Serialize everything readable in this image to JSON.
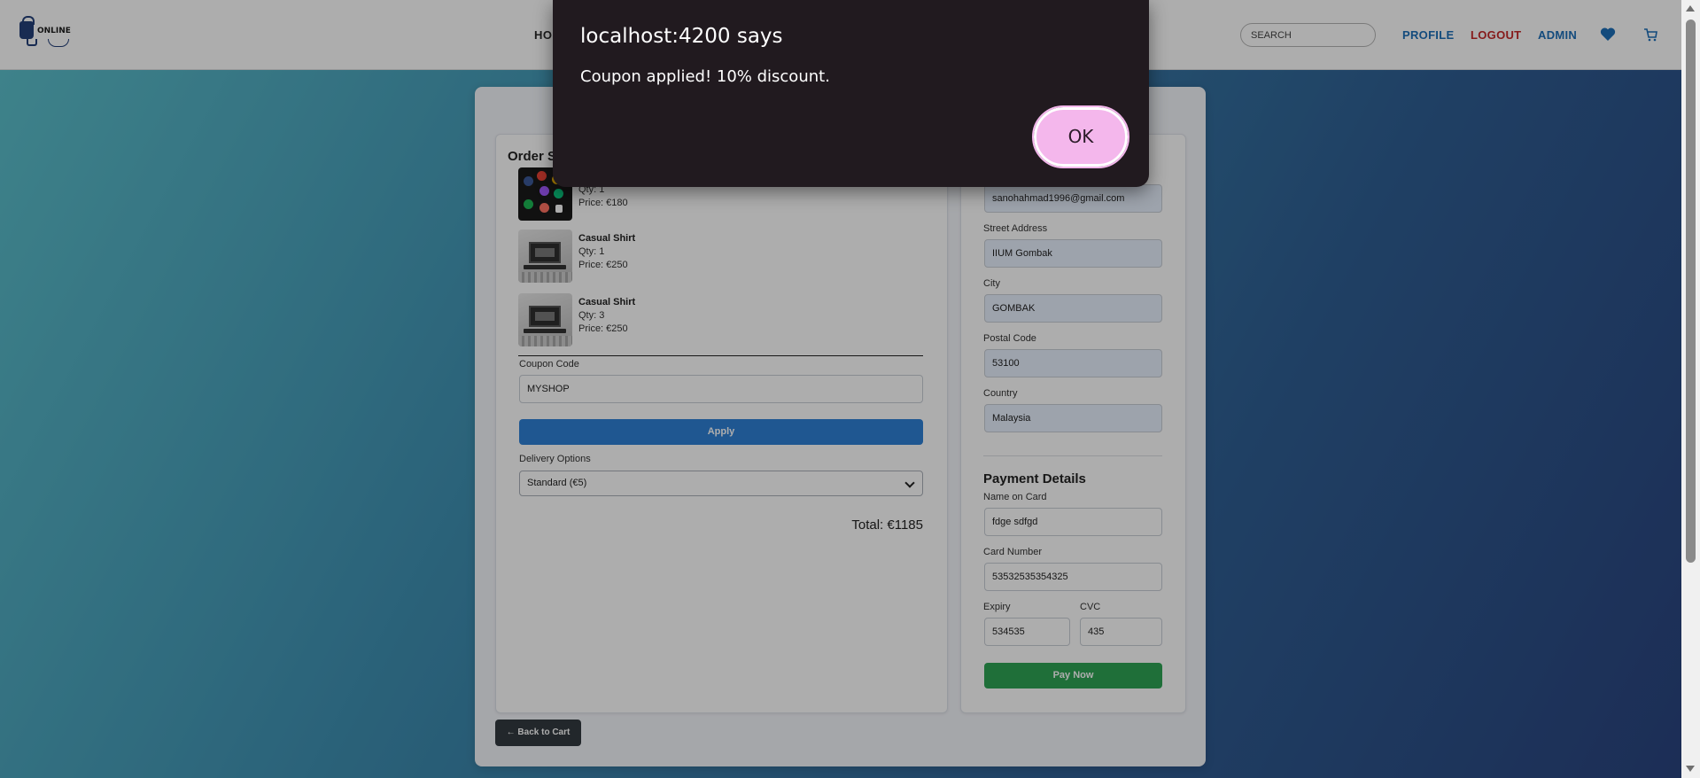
{
  "header": {
    "logo_text": "ONLINE",
    "nav_home": "HO",
    "search_placeholder": "SEARCH",
    "profile": "PROFILE",
    "logout": "LOGOUT",
    "admin": "ADMIN",
    "icons": [
      "heart-icon",
      "cart-icon"
    ]
  },
  "order": {
    "title": "Order S",
    "items": [
      {
        "name": "",
        "qty": "Qty: 1",
        "price": "Price: €180",
        "image": "apps-collage"
      },
      {
        "name": "Casual Shirt",
        "qty": "Qty: 1",
        "price": "Price: €250",
        "image": "laptop-desk"
      },
      {
        "name": "Casual Shirt",
        "qty": "Qty: 3",
        "price": "Price: €250",
        "image": "laptop-desk"
      }
    ],
    "coupon_label": "Coupon Code",
    "coupon_value": "MYSHOP",
    "apply_label": "Apply",
    "delivery_label": "Delivery Options",
    "delivery_value": "Standard (€5)",
    "total": "Total: €1185"
  },
  "shipping": {
    "email_value": "sanohahmad1996@gmail.com",
    "street_label": "Street Address",
    "street_value": "IIUM Gombak",
    "city_label": "City",
    "city_value": "GOMBAK",
    "postal_label": "Postal Code",
    "postal_value": "53100",
    "country_label": "Country",
    "country_value": "Malaysia"
  },
  "payment": {
    "title": "Payment Details",
    "name_label": "Name on Card",
    "name_value": "fdge sdfgd",
    "card_label": "Card Number",
    "card_value": "53532535354325",
    "expiry_label": "Expiry",
    "expiry_value": "534535",
    "cvc_label": "CVC",
    "cvc_value": "435",
    "pay_label": "Pay Now"
  },
  "back_label": "← Back to Cart",
  "dialog": {
    "title": "localhost:4200 says",
    "message": "Coupon applied! 10% discount.",
    "ok_label": "OK"
  },
  "colors": {
    "primary": "#2f80d6",
    "pay": "#2ea455",
    "logout": "#c62828",
    "dialog_bg": "#211a1f",
    "ok_button": "#f4b7ec"
  }
}
